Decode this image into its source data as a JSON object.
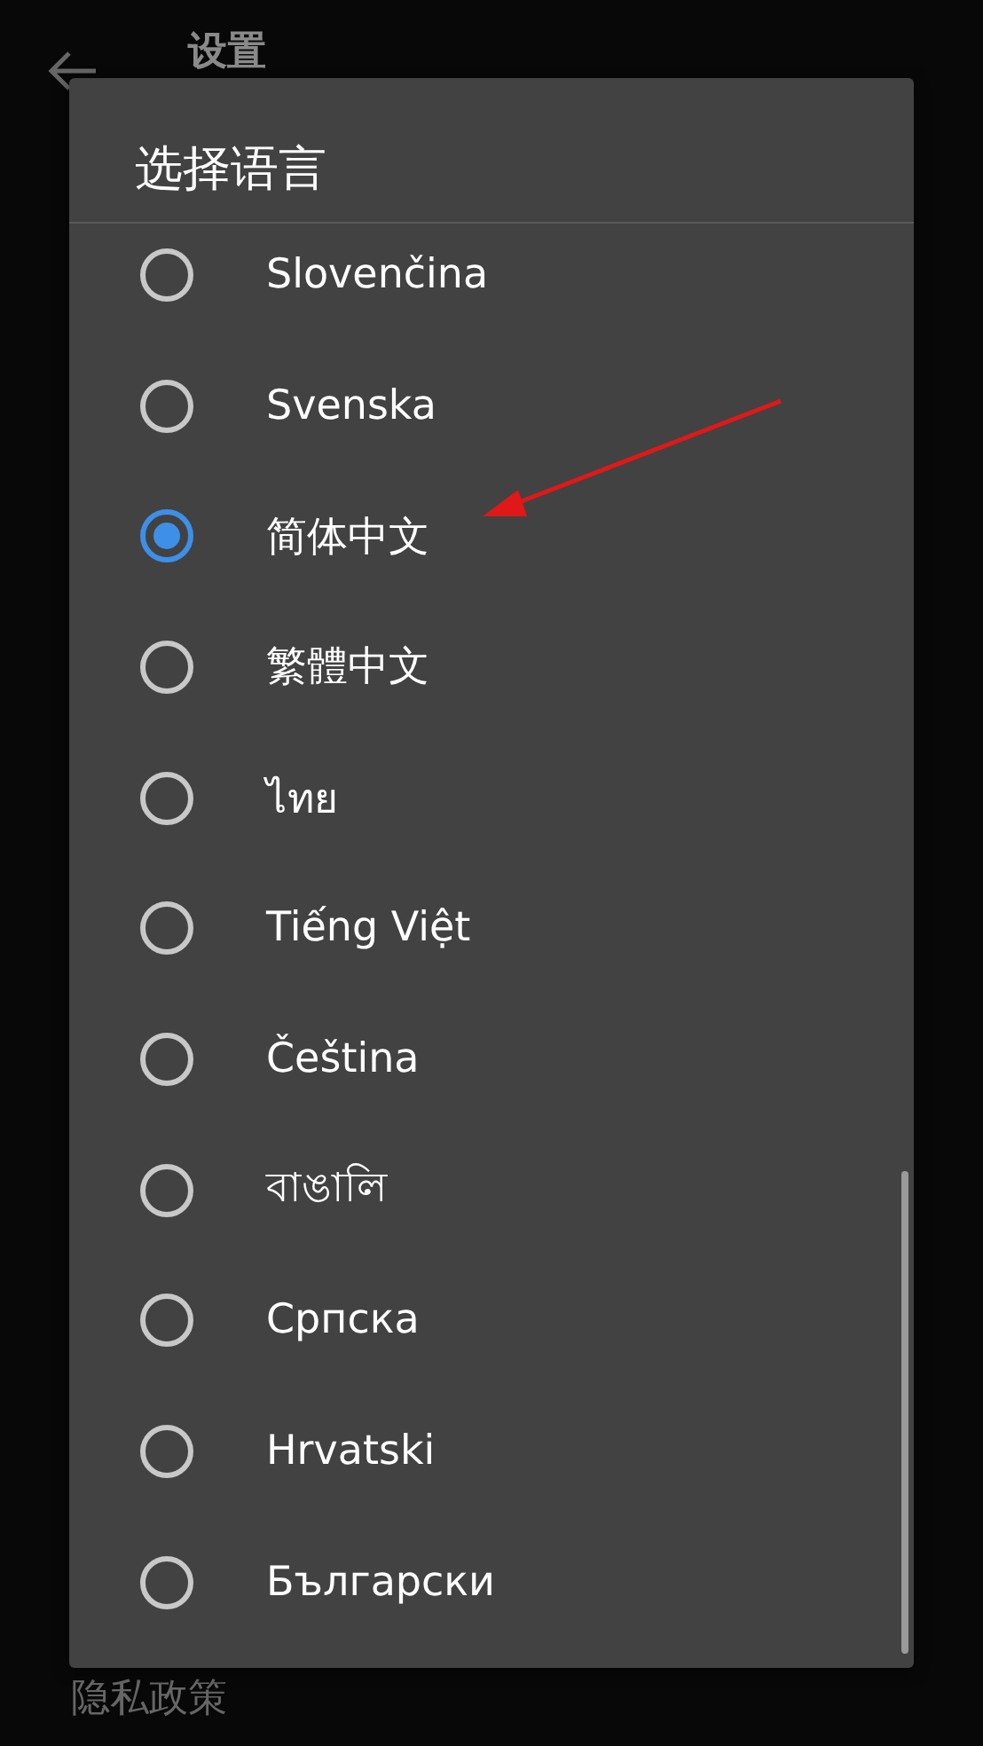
{
  "app_bar": {
    "title": "设置"
  },
  "dialog": {
    "title": "选择语言",
    "options": [
      {
        "label": "Slovenčina",
        "selected": false
      },
      {
        "label": "Svenska",
        "selected": false
      },
      {
        "label": "简体中文",
        "selected": true
      },
      {
        "label": "繁體中文",
        "selected": false
      },
      {
        "label": "ไทย",
        "selected": false
      },
      {
        "label": "Tiếng Việt",
        "selected": false
      },
      {
        "label": "Čeština",
        "selected": false
      },
      {
        "label": "বাঙালি",
        "selected": false
      },
      {
        "label": "Српска",
        "selected": false
      },
      {
        "label": "Hrvatski",
        "selected": false
      },
      {
        "label": "Български",
        "selected": false
      }
    ]
  },
  "settings_items": [
    {
      "label": "隐私政策"
    }
  ]
}
